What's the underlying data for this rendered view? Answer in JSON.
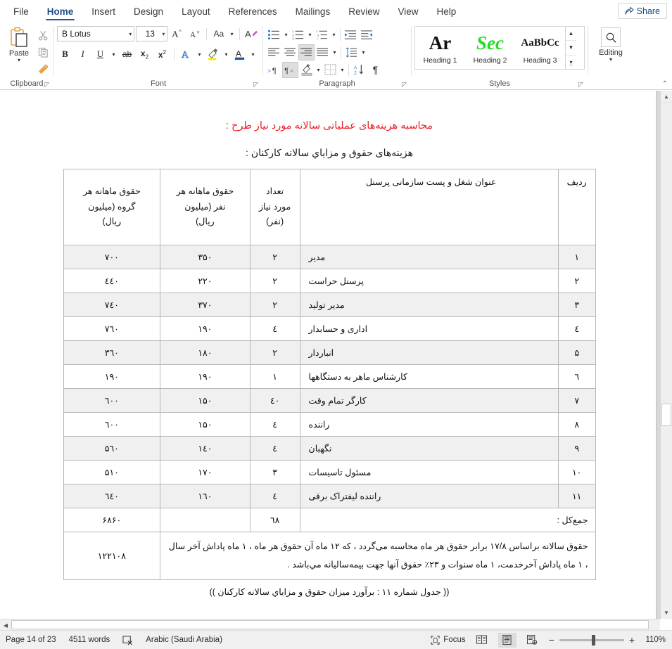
{
  "window": {
    "share_label": "Share"
  },
  "tabs": [
    {
      "label": "File",
      "active": false
    },
    {
      "label": "Home",
      "active": true
    },
    {
      "label": "Insert",
      "active": false
    },
    {
      "label": "Design",
      "active": false
    },
    {
      "label": "Layout",
      "active": false
    },
    {
      "label": "References",
      "active": false
    },
    {
      "label": "Mailings",
      "active": false
    },
    {
      "label": "Review",
      "active": false
    },
    {
      "label": "View",
      "active": false
    },
    {
      "label": "Help",
      "active": false
    }
  ],
  "ribbon": {
    "clipboard": {
      "group_label": "Clipboard",
      "paste_label": "Paste",
      "icons": [
        "paste-icon",
        "cut-scissors-icon",
        "copy-icon",
        "format-painter-icon"
      ]
    },
    "font": {
      "group_label": "Font",
      "font_name": "B Lotus",
      "font_size": "13",
      "icons": [
        "grow-font-icon",
        "shrink-font-icon",
        "change-case-icon",
        "clear-formatting-icon",
        "bold-icon",
        "italic-icon",
        "underline-icon",
        "strikethrough-icon",
        "subscript-icon",
        "superscript-icon",
        "text-effects-icon",
        "text-highlight-color-icon",
        "font-color-icon"
      ]
    },
    "paragraph": {
      "group_label": "Paragraph",
      "icons": [
        "bullets-icon",
        "numbering-icon",
        "multilevel-list-icon",
        "decrease-indent-icon",
        "increase-indent-icon",
        "align-left-icon",
        "align-center-icon",
        "align-right-icon",
        "justify-icon",
        "line-spacing-icon",
        "ltr-text-direction-icon",
        "rtl-text-direction-icon",
        "shading-icon",
        "borders-icon",
        "sort-icon",
        "show-formatting-marks-icon"
      ]
    },
    "styles": {
      "group_label": "Styles",
      "items": [
        {
          "preview": "Ar",
          "name": "Heading 1"
        },
        {
          "preview": "Sec",
          "name": "Heading 2"
        },
        {
          "preview": "AaBbCc",
          "name": "Heading 3"
        }
      ]
    },
    "editing": {
      "group_label": "Editing",
      "label": "Editing",
      "icon": "search-icon"
    }
  },
  "document": {
    "heading_red": "محاسبه هزینه‌های عملیاتی سالانه مورد نیاز طرح :",
    "heading_sub": "هزینه‌های حقوق و مزایاي سالانه كاركنان :",
    "table": {
      "headers": {
        "row_no": "ردیف",
        "job_title": "عنوان شغل و پست سازمانی پرسنل",
        "count": "تعداد\nمورد نیاز\n(نفر)",
        "count_lines": [
          "تعداد",
          "مورد نیاز",
          "(نفر)"
        ],
        "per_person": "حقوق ماهانه هر\nنفر (میلیون ریال)",
        "per_person_lines": [
          "حقوق ماهانه هر",
          "نفر (میلیون",
          "ریال)"
        ],
        "per_group": "حقوق ماهانه هر\nگروه (میلیون ریال)",
        "per_group_lines": [
          "حقوق ماهانه هر",
          "گروه (میلیون",
          "ریال)"
        ]
      },
      "rows": [
        {
          "no": "۱",
          "title": "مدیر",
          "count": "۲",
          "per_person": "۳۵۰",
          "per_group": "۷۰۰"
        },
        {
          "no": "۲",
          "title": "پرسنل حراست",
          "count": "۲",
          "per_person": "۲۲۰",
          "per_group": "٤٤۰"
        },
        {
          "no": "۳",
          "title": "مدیر تولید",
          "count": "۲",
          "per_person": "۳۷۰",
          "per_group": "۷٤۰"
        },
        {
          "no": "٤",
          "title": "اداری و حسابدار",
          "count": "٤",
          "per_person": "۱۹۰",
          "per_group": "۷٦۰"
        },
        {
          "no": "۵",
          "title": "انباردار",
          "count": "۲",
          "per_person": "۱۸۰",
          "per_group": "۳٦۰"
        },
        {
          "no": "٦",
          "title": "کارشناس ماهر به دستگاهها",
          "count": "۱",
          "per_person": "۱۹۰",
          "per_group": "۱۹۰"
        },
        {
          "no": "۷",
          "title": "کارگر تمام وقت",
          "count": "٤۰",
          "per_person": "۱۵۰",
          "per_group": "٦۰۰"
        },
        {
          "no": "۸",
          "title": "راننده",
          "count": "٤",
          "per_person": "۱۵۰",
          "per_group": "٦۰۰"
        },
        {
          "no": "۹",
          "title": "نگهبان",
          "count": "٤",
          "per_person": "۱٤۰",
          "per_group": "۵٦۰"
        },
        {
          "no": "۱۰",
          "title": "مسئول تاسیسات",
          "count": "۳",
          "per_person": "۱۷۰",
          "per_group": "۵۱۰"
        },
        {
          "no": "۱۱",
          "title": "راننده لیفتراک برقی",
          "count": "٤",
          "per_person": "۱٦۰",
          "per_group": "٦٤۰"
        }
      ],
      "total_row": {
        "label": "جمع‌کل :",
        "count": "٦۸",
        "per_person": "",
        "per_group": "۶۸۶۰"
      },
      "note_row": {
        "text": "حقوق سالانه براساس ۱۷/۸ برابر حقوق هر ماه محاسبه  می‌گردد ، که ۱۲ ماه آن حقوق هر ماه ، ۱ ماه پاداش آخر سال ، ۱ ماه پاداش آخرخدمت، ۱ ماه سنوات و ۲۳٪ حقوق آنها جهت بیمه‌سالیانه مي‌باشد .",
        "value": "۱۲۲۱۰۸"
      }
    },
    "caption": "(( جدول شماره ۱۱ : برآورد میزان حقوق و مزایاي سالانه کارکنان ))"
  },
  "status_bar": {
    "page": "Page 14 of 23",
    "words": "4511 words",
    "proofing_icon": "proofing-errors-icon",
    "language": "Arabic (Saudi Arabia)",
    "focus": "Focus",
    "views": [
      "read-mode-icon",
      "print-layout-icon",
      "web-layout-icon"
    ],
    "zoom_out": "−",
    "zoom_in": "+",
    "zoom_percent": "110%"
  },
  "colors": {
    "accent": "#2b579a",
    "heading_red": "#e8232a",
    "row_shade": "#f0f0f0",
    "ribbon_bg": "#ffffff"
  }
}
